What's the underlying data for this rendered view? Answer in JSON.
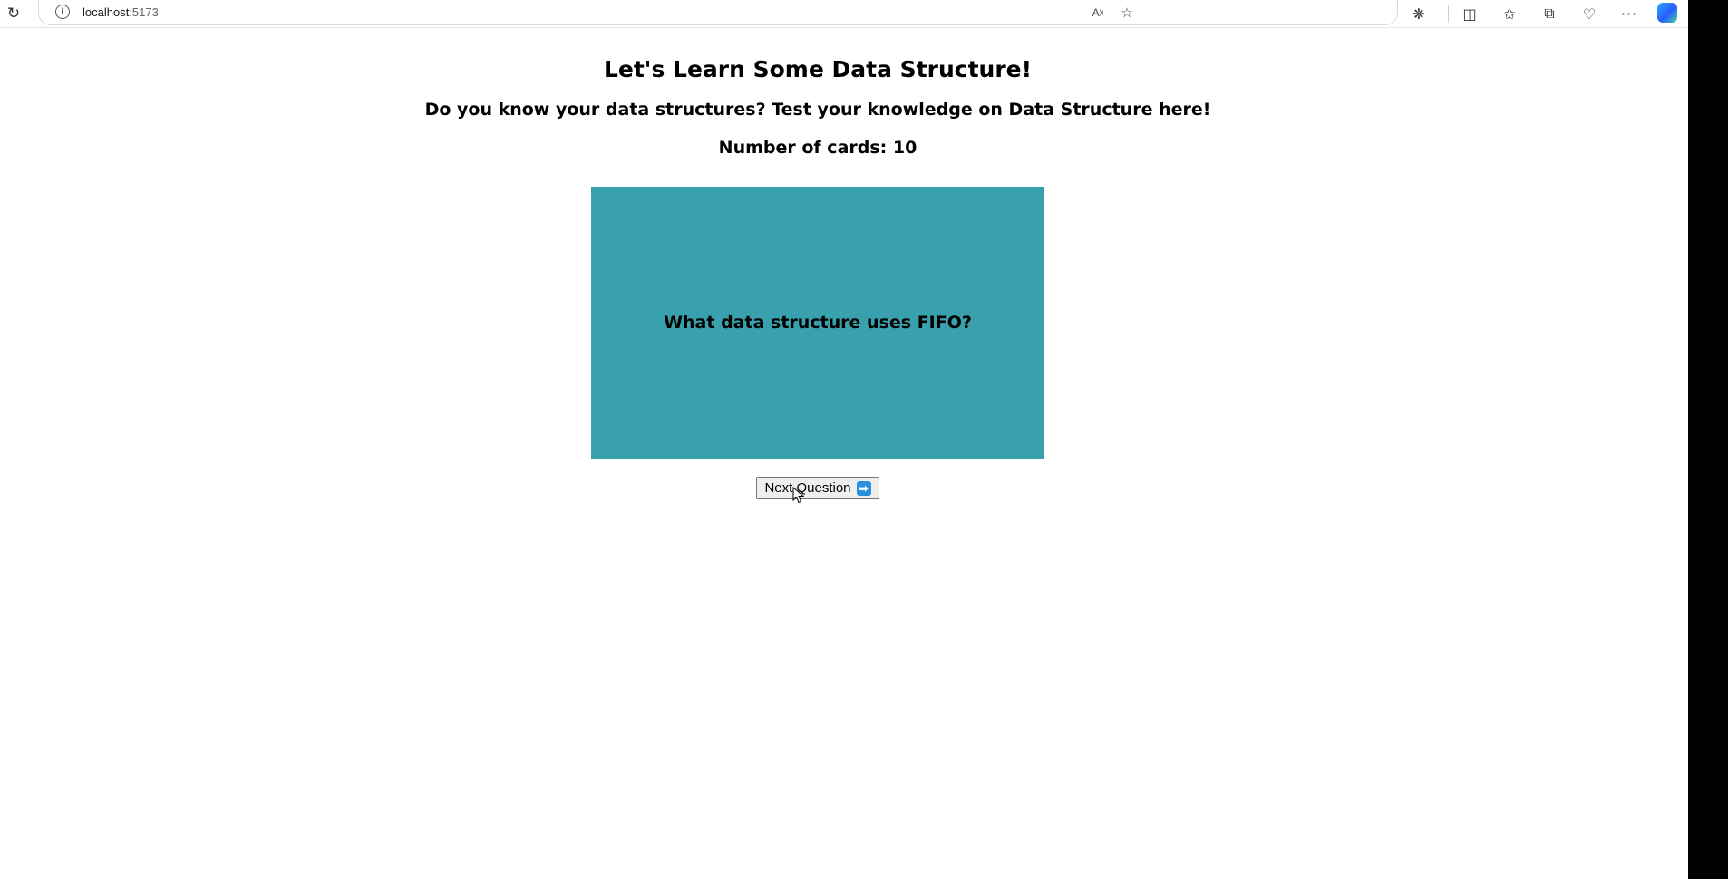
{
  "browser": {
    "url_host": "localhost",
    "url_port": ":5173",
    "icons": {
      "reload": "reload-icon",
      "site_info": "info-icon",
      "read_aloud": "read-aloud-icon",
      "favorite": "star-icon",
      "extensions": "puzzle-icon",
      "split_screen": "split-screen-icon",
      "favorites": "favorites-list-icon",
      "collections": "collections-icon",
      "browser_essentials": "heart-pulse-icon",
      "more": "more-icon",
      "copilot": "copilot-icon"
    }
  },
  "page": {
    "title": "Let's Learn Some Data Structure!",
    "subtitle": "Do you know your data structures? Test your knowledge on Data Structure here!",
    "card_count_label": "Number of cards: 10",
    "card": {
      "question": "What data structure uses FIFO?",
      "color": "#39a0ad"
    },
    "next_button": {
      "label": "Next Question",
      "icon": "right-arrow-icon"
    }
  }
}
